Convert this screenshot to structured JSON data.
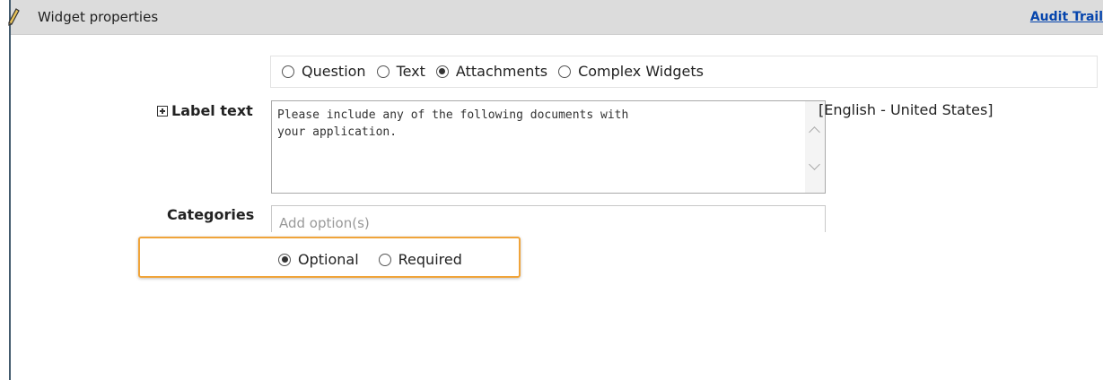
{
  "header": {
    "title": "Widget properties",
    "audit_link": "Audit Trail",
    "icon": "pencil-icon"
  },
  "widget_type": {
    "options": [
      "Question",
      "Text",
      "Attachments",
      "Complex Widgets"
    ],
    "selected": "Attachments"
  },
  "label_text": {
    "label": "Label text",
    "value": "Please include any of the following documents with\nyour application.",
    "language": "[English - United States]"
  },
  "categories": {
    "label": "Categories",
    "placeholder": "Add option(s)"
  },
  "requirement": {
    "options": [
      "Optional",
      "Required"
    ],
    "selected": "Optional"
  },
  "colors": {
    "header_bg": "#dcdcdc",
    "link": "#0645ad",
    "highlight": "#f0a43a"
  }
}
